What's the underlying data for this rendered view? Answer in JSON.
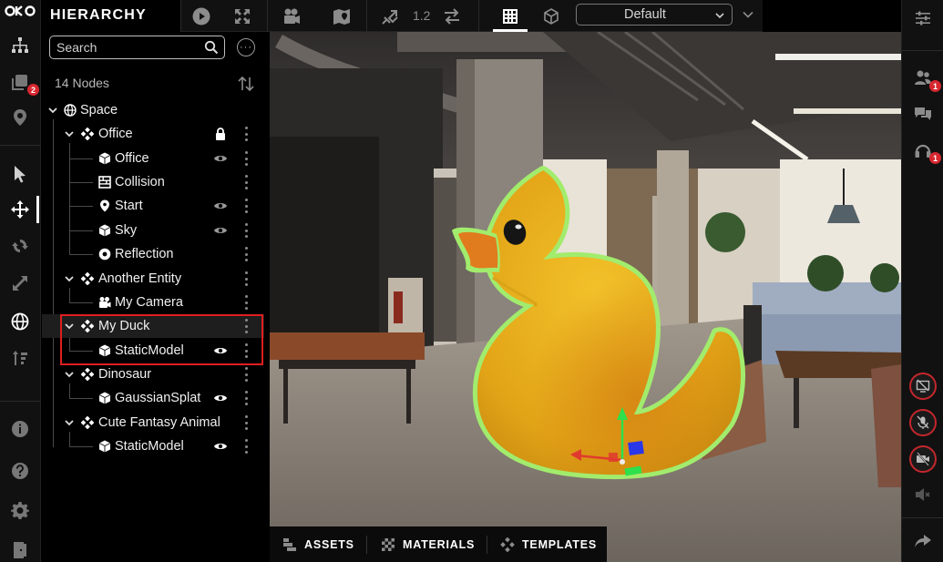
{
  "app": {
    "logo_text": "OKO"
  },
  "left_rail": {
    "items": [
      {
        "name": "hierarchy-icon"
      },
      {
        "name": "layers-icon",
        "badge": "2"
      },
      {
        "name": "location-pin-icon"
      },
      {
        "name": "select-cursor-icon"
      },
      {
        "name": "move-icon"
      },
      {
        "name": "rotate-icon"
      },
      {
        "name": "scale-icon"
      },
      {
        "name": "globe-icon"
      },
      {
        "name": "snap-icon"
      },
      {
        "name": "info-icon"
      },
      {
        "name": "help-icon"
      },
      {
        "name": "settings-gear-icon"
      },
      {
        "name": "exit-door-icon"
      }
    ]
  },
  "hierarchy": {
    "title": "HIERARCHY",
    "search_placeholder": "Search",
    "nodes_count": "14 Nodes",
    "tree": [
      {
        "label": "Space",
        "icon": "globe-icon"
      },
      {
        "label": "Office",
        "icon": "entity-icon",
        "locked": true
      },
      {
        "label": "Office",
        "icon": "cube-icon",
        "visible": true
      },
      {
        "label": "Collision",
        "icon": "collision-icon"
      },
      {
        "label": "Start",
        "icon": "pin-icon",
        "visible": true
      },
      {
        "label": "Sky",
        "icon": "cube-icon",
        "visible": true
      },
      {
        "label": "Reflection",
        "icon": "reflection-icon"
      },
      {
        "label": "Another Entity",
        "icon": "entity-icon"
      },
      {
        "label": "My Camera",
        "icon": "camera-icon"
      },
      {
        "label": "My Duck",
        "icon": "entity-icon",
        "selected": true
      },
      {
        "label": "StaticModel",
        "icon": "cube-icon",
        "visible": true,
        "selected": true
      },
      {
        "label": "Dinosaur",
        "icon": "entity-icon"
      },
      {
        "label": "GaussianSplat",
        "icon": "cube-icon",
        "visible": true
      },
      {
        "label": "Cute Fantasy Animal",
        "icon": "entity-icon"
      },
      {
        "label": "StaticModel",
        "icon": "cube-icon",
        "visible": true
      }
    ]
  },
  "toolbar": {
    "speed_value": "1.2",
    "view_preset": "Default"
  },
  "right_rail": {
    "users_badge": "1",
    "audio_badge": "1"
  },
  "bottom_tabs": [
    {
      "label": "ASSETS"
    },
    {
      "label": "MATERIALS"
    },
    {
      "label": "TEMPLATES"
    }
  ],
  "colors": {
    "highlight_border": "#e01e1e",
    "badge": "#d7262e",
    "selection_outline": "#8ee06a",
    "duck_body": "#e7b21a"
  }
}
